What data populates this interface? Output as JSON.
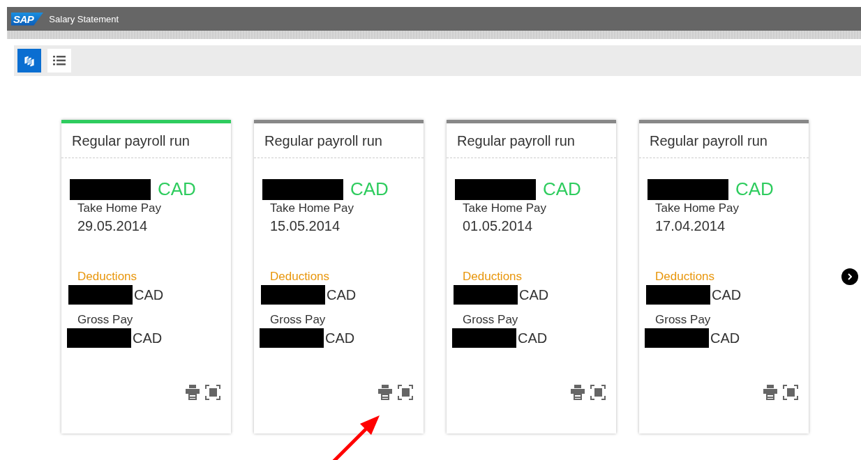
{
  "window": {
    "logo": "SAP",
    "title": "Salary Statement"
  },
  "view_toggle": [
    {
      "kind": "tiles",
      "selected": true
    },
    {
      "kind": "list",
      "selected": false
    }
  ],
  "statements": [
    {
      "title": "Regular payroll run",
      "selected": true,
      "net_currency": "CAD",
      "net_label": "Take Home Pay",
      "date": "29.05.2014",
      "deductions_label": "Deductions",
      "deductions_currency": "CAD",
      "gross_label": "Gross Pay",
      "gross_currency": "CAD"
    },
    {
      "title": "Regular payroll run",
      "selected": false,
      "net_currency": "CAD",
      "net_label": "Take Home Pay",
      "date": "15.05.2014",
      "deductions_label": "Deductions",
      "deductions_currency": "CAD",
      "gross_label": "Gross Pay",
      "gross_currency": "CAD"
    },
    {
      "title": "Regular payroll run",
      "selected": false,
      "net_currency": "CAD",
      "net_label": "Take Home Pay",
      "date": "01.05.2014",
      "deductions_label": "Deductions",
      "deductions_currency": "CAD",
      "gross_label": "Gross Pay",
      "gross_currency": "CAD"
    },
    {
      "title": "Regular payroll run",
      "selected": false,
      "net_currency": "CAD",
      "net_label": "Take Home Pay",
      "date": "17.04.2014",
      "deductions_label": "Deductions",
      "deductions_currency": "CAD",
      "gross_label": "Gross Pay",
      "gross_currency": "CAD"
    }
  ]
}
